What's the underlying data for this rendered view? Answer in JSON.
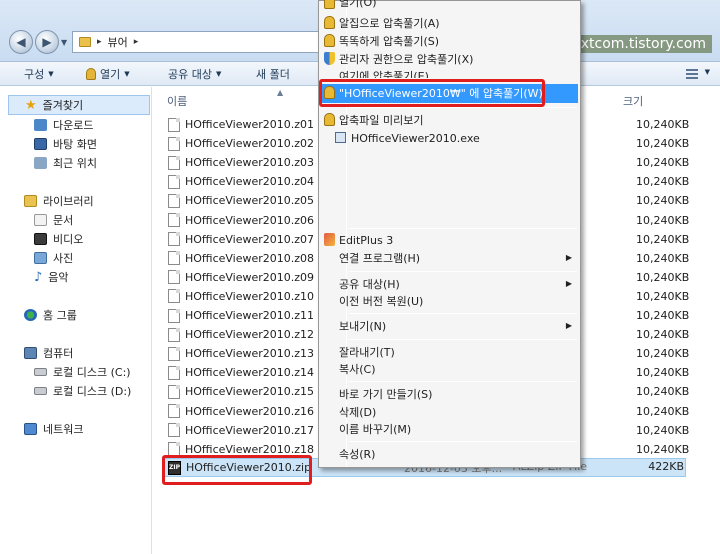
{
  "window": {
    "breadcrumb": "뷰어",
    "watermark": "http://nextcom.tistory.com"
  },
  "toolbar": {
    "organize": "구성",
    "open": "열기",
    "share": "공유 대상",
    "new_folder": "새 폴더"
  },
  "sidebar": {
    "favorites": "즐겨찾기",
    "downloads": "다운로드",
    "desktop": "바탕 화면",
    "recent": "최근 위치",
    "libraries": "라이브러리",
    "documents": "문서",
    "videos": "비디오",
    "pictures": "사진",
    "music": "음악",
    "homegroup": "홈 그룹",
    "computer": "컴퓨터",
    "drive_c": "로컬 디스크 (C:)",
    "drive_d": "로컬 디스크 (D:)",
    "network": "네트워크"
  },
  "list": {
    "col_name": "이름",
    "col_size": "크기",
    "files": [
      {
        "name": "HOfficeViewer2010.z01",
        "size": "10,240KB"
      },
      {
        "name": "HOfficeViewer2010.z02",
        "size": "10,240KB"
      },
      {
        "name": "HOfficeViewer2010.z03",
        "size": "10,240KB"
      },
      {
        "name": "HOfficeViewer2010.z04",
        "size": "10,240KB"
      },
      {
        "name": "HOfficeViewer2010.z05",
        "size": "10,240KB"
      },
      {
        "name": "HOfficeViewer2010.z06",
        "size": "10,240KB"
      },
      {
        "name": "HOfficeViewer2010.z07",
        "size": "10,240KB"
      },
      {
        "name": "HOfficeViewer2010.z08",
        "size": "10,240KB"
      },
      {
        "name": "HOfficeViewer2010.z09",
        "size": "10,240KB"
      },
      {
        "name": "HOfficeViewer2010.z10",
        "size": "10,240KB"
      },
      {
        "name": "HOfficeViewer2010.z11",
        "size": "10,240KB"
      },
      {
        "name": "HOfficeViewer2010.z12",
        "size": "10,240KB"
      },
      {
        "name": "HOfficeViewer2010.z13",
        "size": "10,240KB"
      },
      {
        "name": "HOfficeViewer2010.z14",
        "size": "10,240KB"
      },
      {
        "name": "HOfficeViewer2010.z15",
        "size": "10,240KB"
      },
      {
        "name": "HOfficeViewer2010.z16",
        "size": "10,240KB"
      },
      {
        "name": "HOfficeViewer2010.z17",
        "size": "10,240KB"
      },
      {
        "name": "HOfficeViewer2010.z18",
        "size": "10,240KB"
      }
    ],
    "zip": {
      "name": "HOfficeViewer2010.zip",
      "date": "2016-12-03 오후...",
      "type": "ALZip ZIP File",
      "size": "422KB"
    }
  },
  "menu": {
    "partial_top": "열기(O)",
    "extract_here_alzip": "알집으로 압축풀기(A)",
    "smart_extract": "똑똑하게 압축풀기(S)",
    "admin_extract": "관리자 권한으로 압축풀기(X)",
    "extract_here": "여기에 압축풀기(E)",
    "extract_folder": "\"HOfficeViewer2010₩\" 에 압축풀기(W)",
    "preview": "압축파일 미리보기",
    "preview_file": "HOfficeViewer2010.exe",
    "editplus": "EditPlus 3",
    "open_with": "연결 프로그램(H)",
    "share_with": "공유 대상(H)",
    "restore_previous": "이전 버전 복원(U)",
    "send_to": "보내기(N)",
    "cut": "잘라내기(T)",
    "copy": "복사(C)",
    "create_shortcut": "바로 가기 만들기(S)",
    "delete": "삭제(D)",
    "rename": "이름 바꾸기(M)",
    "properties": "속성(R)"
  }
}
